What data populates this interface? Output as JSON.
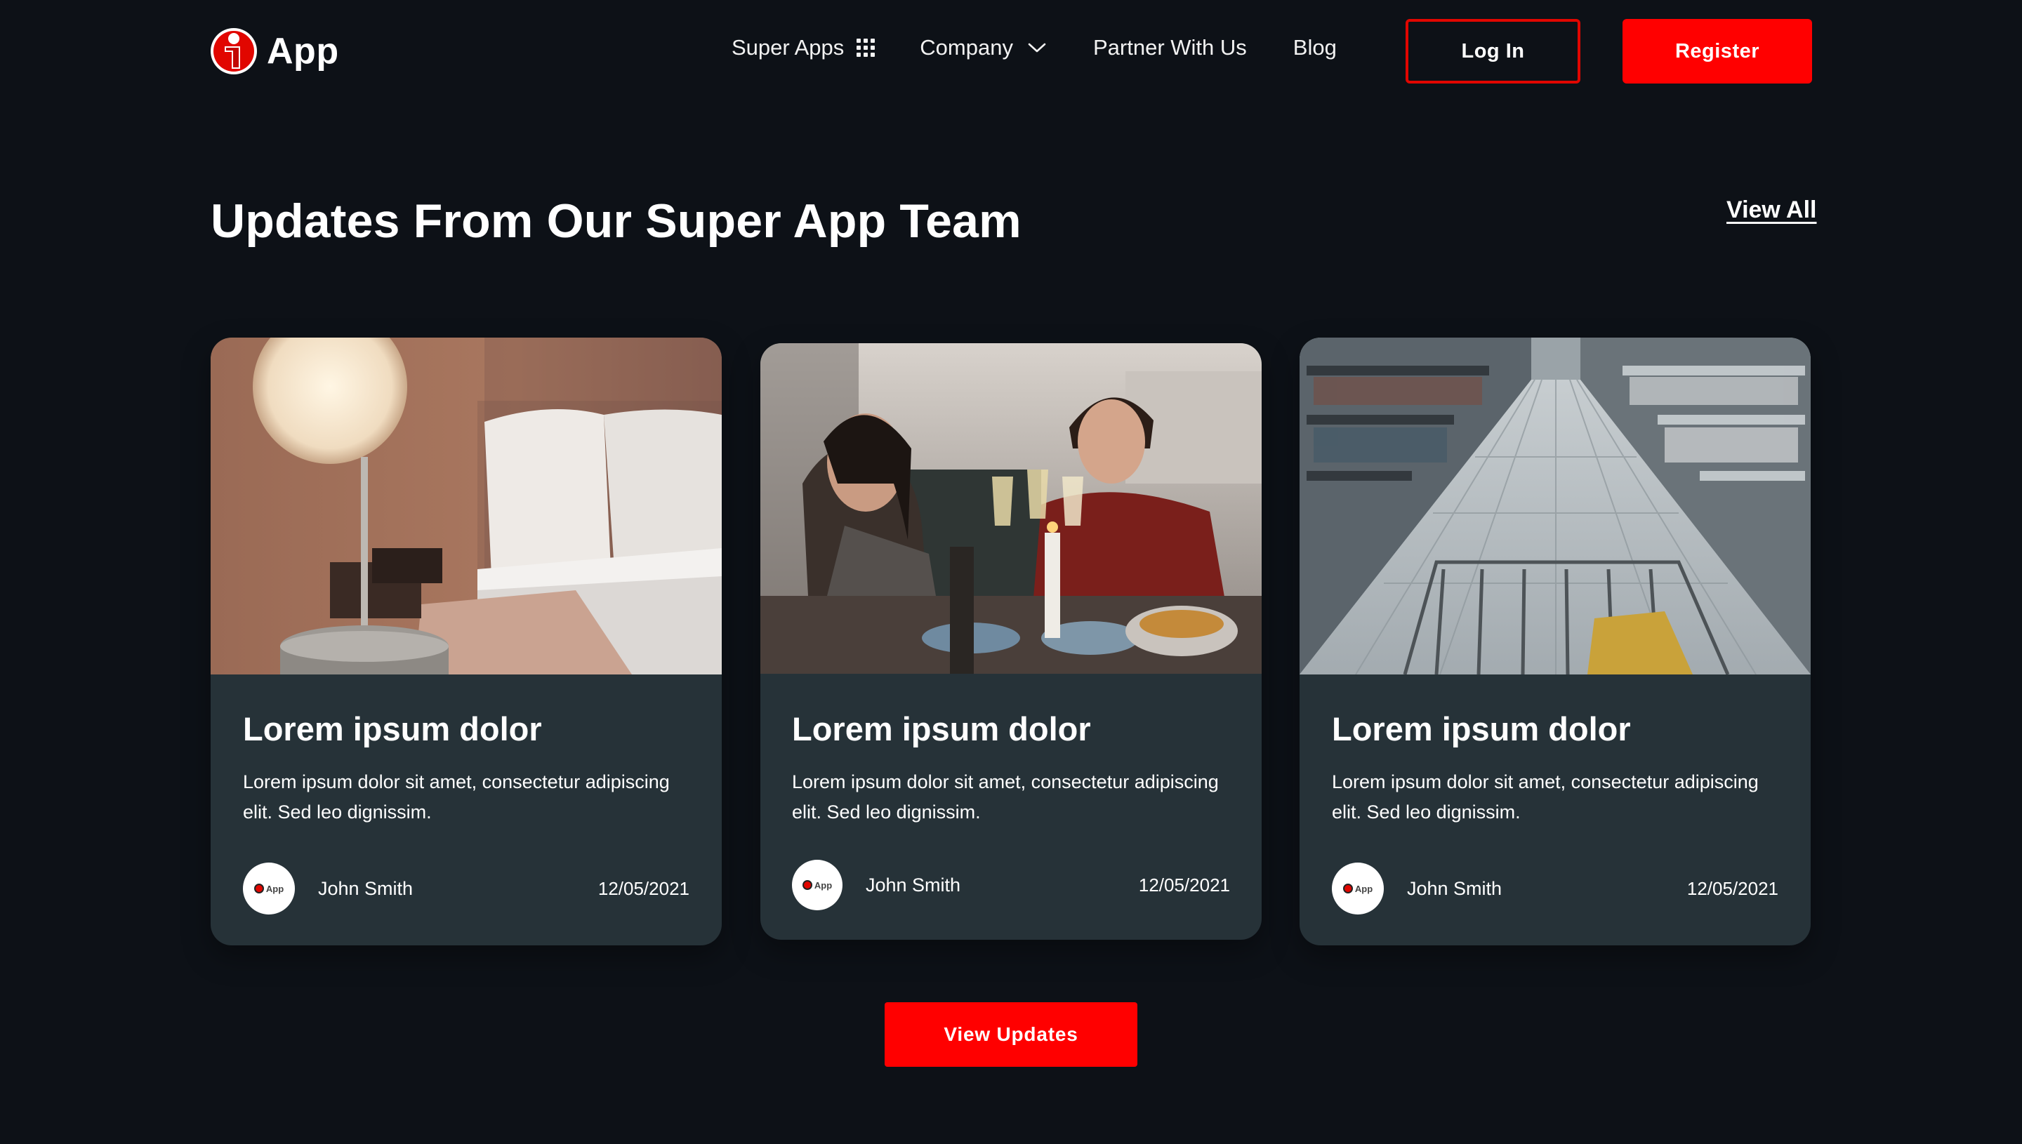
{
  "header": {
    "logo_text": "App",
    "nav": {
      "super_apps": "Super Apps",
      "company": "Company",
      "partner": "Partner With Us",
      "blog": "Blog"
    },
    "login_label": "Log In",
    "register_label": "Register"
  },
  "section": {
    "title": "Updates From Our Super App Team",
    "view_all": "View All"
  },
  "cards": [
    {
      "title": "Lorem ipsum dolor",
      "description": "Lorem ipsum dolor sit amet, consectetur adipiscing elit. Sed leo dignissim.",
      "author": "John Smith",
      "date": "12/05/2021",
      "avatar_text": "App",
      "image": "bedside-lamp-photo"
    },
    {
      "title": "Lorem ipsum dolor",
      "description": "Lorem ipsum dolor sit amet, consectetur adipiscing elit. Sed leo dignissim.",
      "author": "John Smith",
      "date": "12/05/2021",
      "avatar_text": "App",
      "image": "dinner-toast-photo"
    },
    {
      "title": "Lorem ipsum dolor",
      "description": "Lorem ipsum dolor sit amet, consectetur adipiscing elit. Sed leo dignissim.",
      "author": "John Smith",
      "date": "12/05/2021",
      "avatar_text": "App",
      "image": "supermarket-aisle-photo"
    }
  ],
  "cta": {
    "view_updates": "View Updates"
  },
  "colors": {
    "background": "#0d1117",
    "card": "#263238",
    "accent": "#ff0000"
  }
}
